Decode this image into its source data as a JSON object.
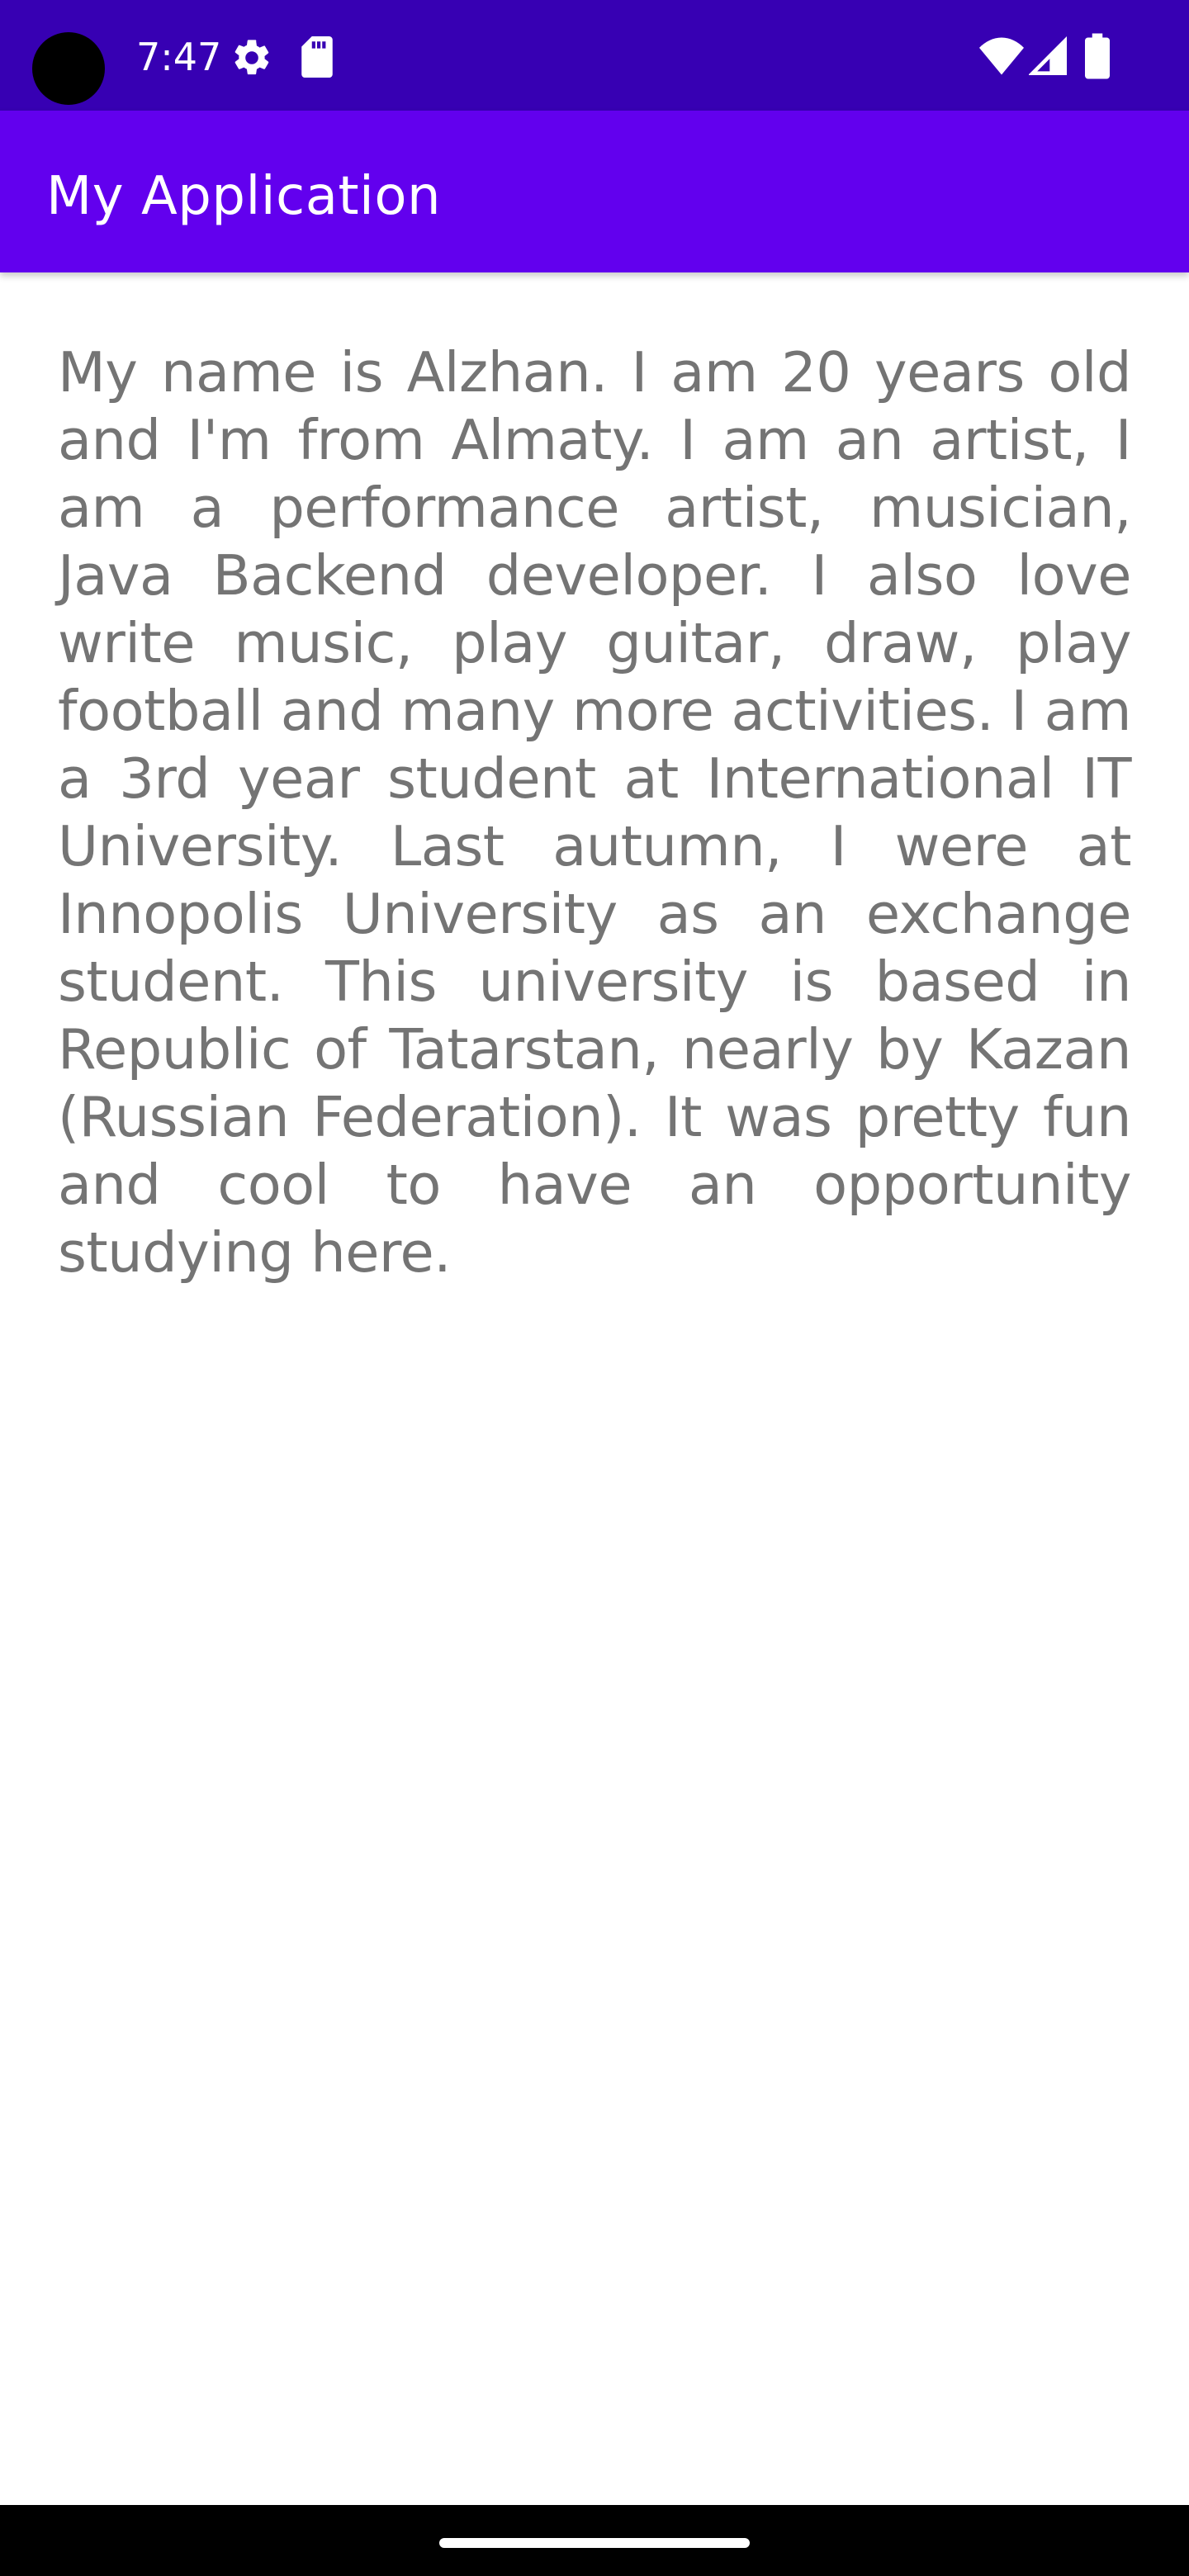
{
  "status_bar": {
    "time": "7:47",
    "left_icons": [
      "settings-icon",
      "sd-card-icon"
    ],
    "right_icons": [
      "wifi-icon",
      "signal-icon",
      "battery-icon"
    ],
    "background_color": "#3700B3"
  },
  "app_bar": {
    "title": "My Application",
    "background_color": "#6200EE"
  },
  "main": {
    "bio": "My name is Alzhan. I am 20 years old and I'm from Almaty. I am an artist, I am a performance artist, musician, Java Backend developer. I also love write music, play guitar, draw, play football and many more activities. I am a 3rd year student at International IT University. Last autumn, I were at Innopolis University as an exchange student. This university is based in Republic of Tatarstan, nearly by Kazan (Russian Federation). It was pretty fun and cool to have an opportunity studying here.",
    "text_color": "#747474"
  },
  "nav_bar": {
    "handle": "home-gesture-handle"
  }
}
